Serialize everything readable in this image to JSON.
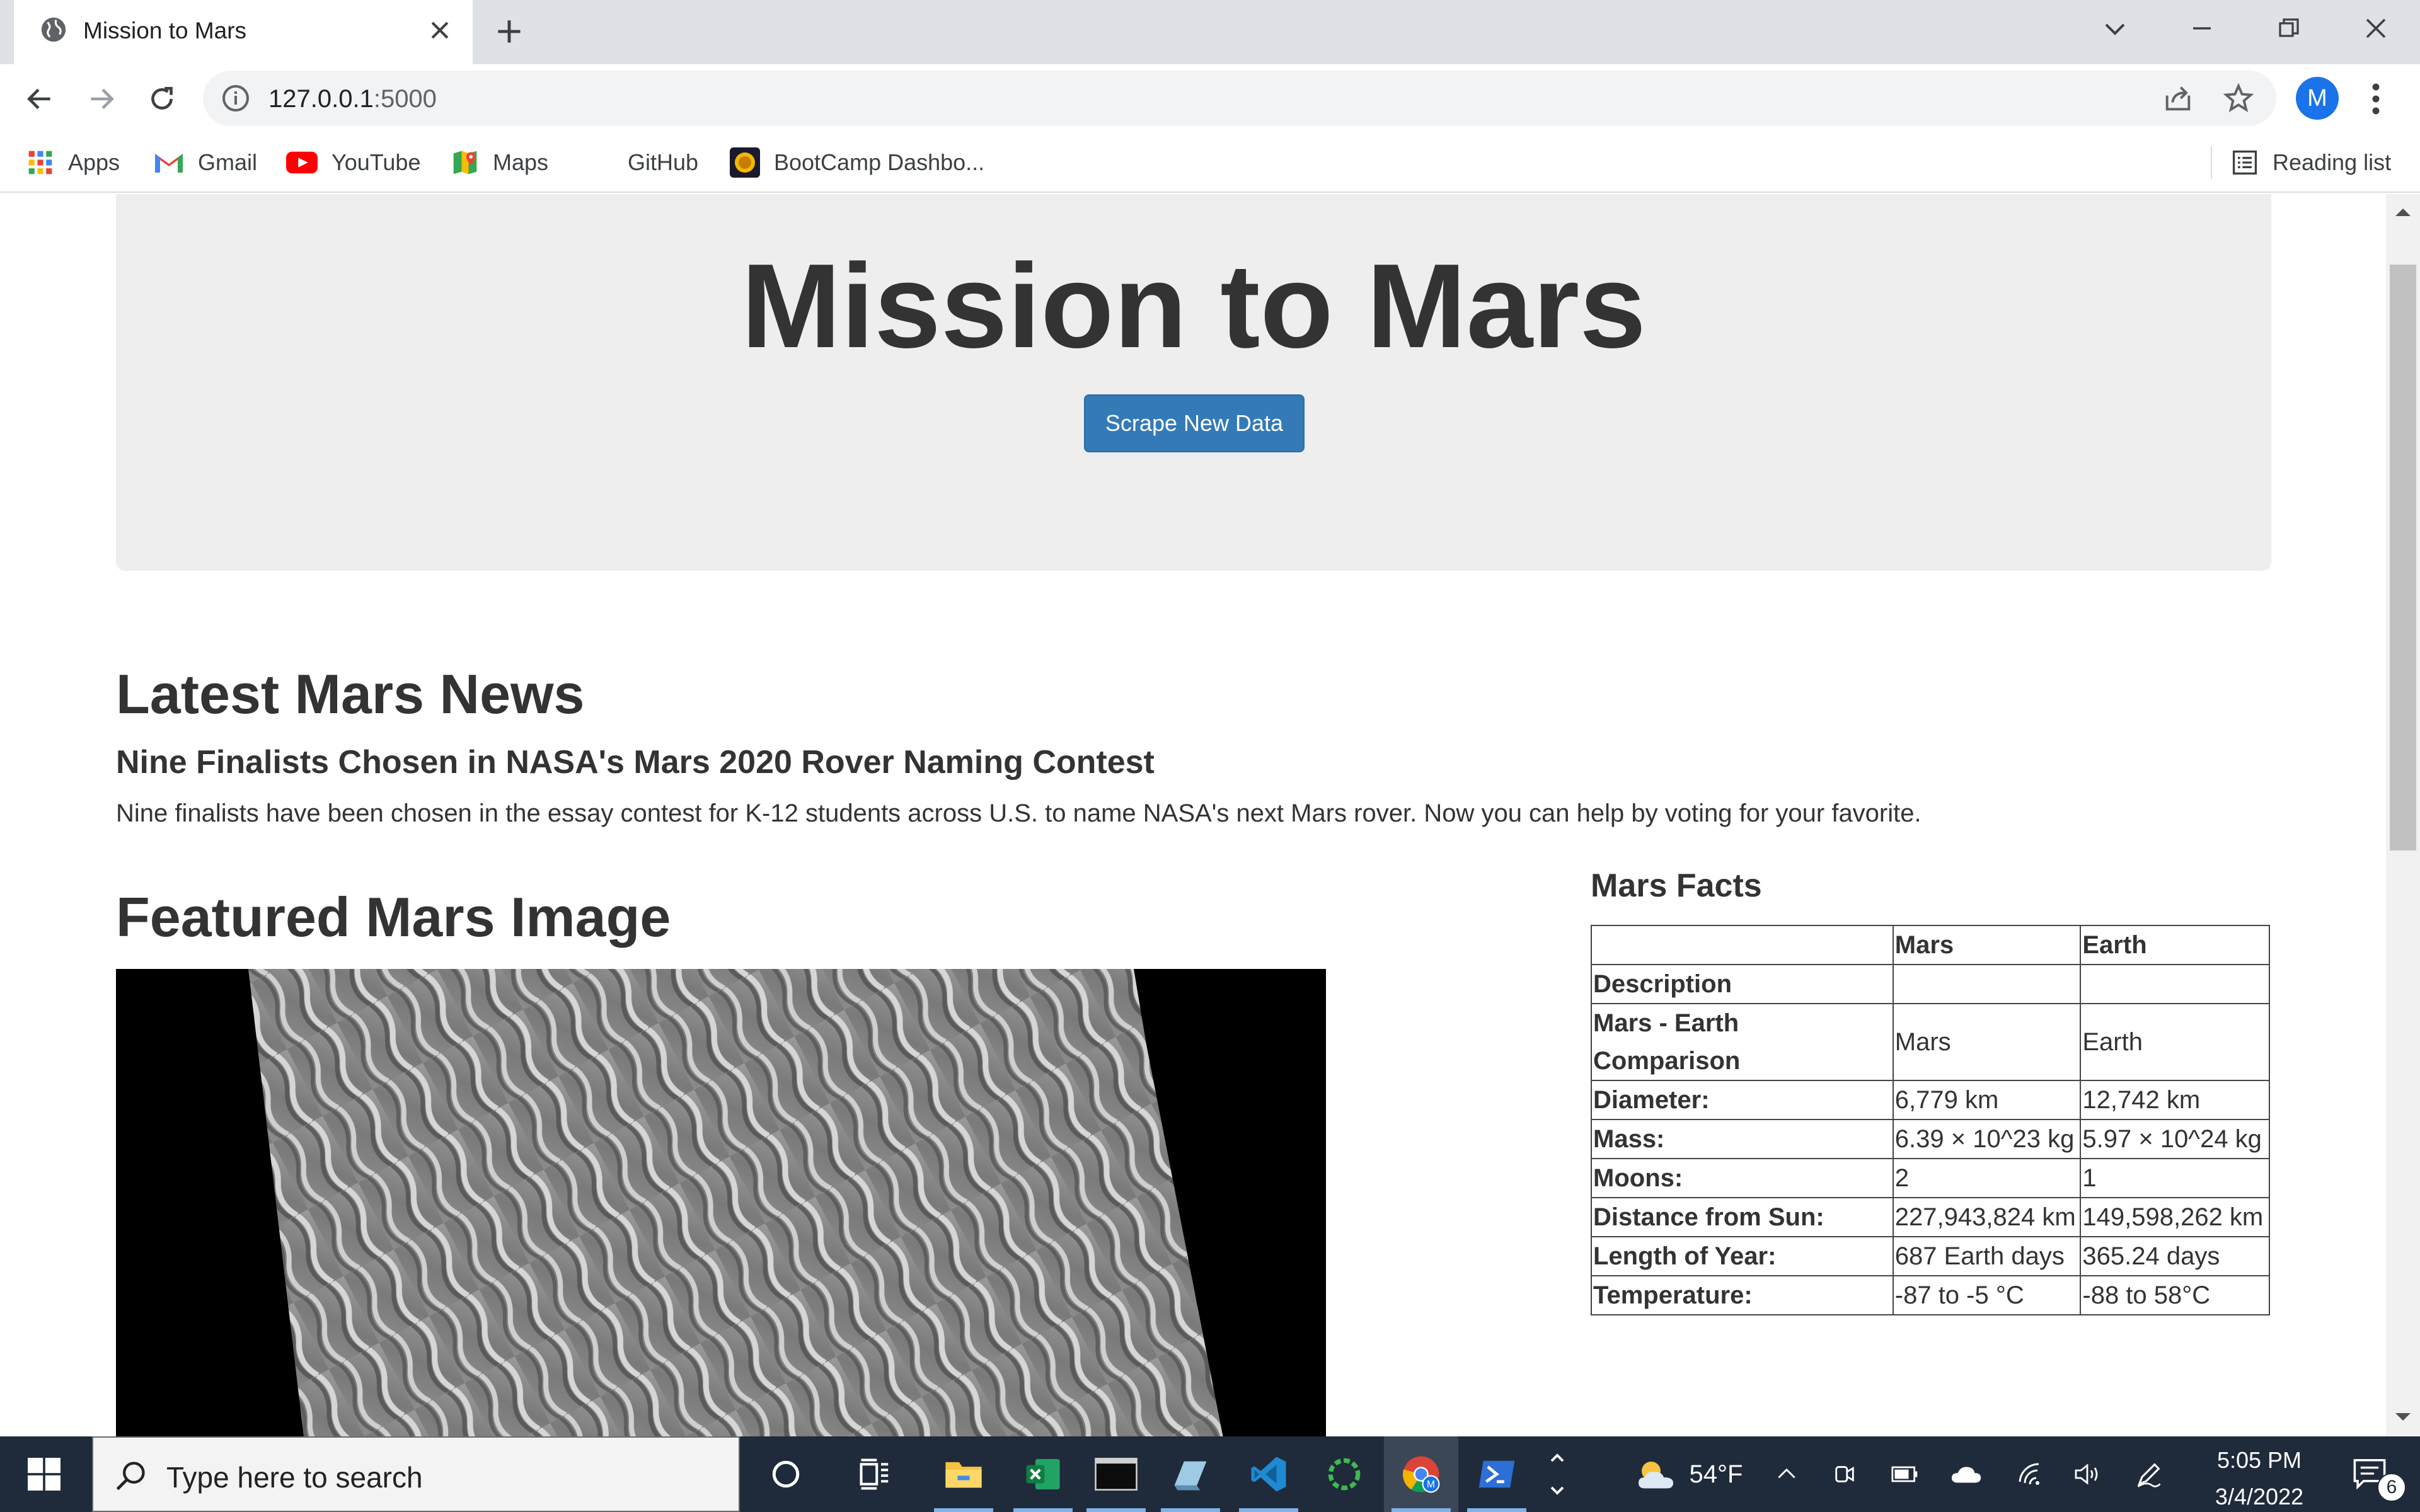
{
  "browser": {
    "tab_title": "Mission to Mars",
    "url_host": "127.0.0.1",
    "url_port": ":5000",
    "profile_initial": "M",
    "bookmarks": [
      {
        "label": "Apps",
        "icon": "apps-grid-icon"
      },
      {
        "label": "Gmail",
        "icon": "gmail-icon"
      },
      {
        "label": "YouTube",
        "icon": "youtube-icon"
      },
      {
        "label": "Maps",
        "icon": "maps-icon"
      },
      {
        "label": "GitHub",
        "icon": "github-icon"
      },
      {
        "label": "BootCamp Dashbo...",
        "icon": "bootcamp-icon"
      }
    ],
    "reading_list": "Reading list"
  },
  "page": {
    "title": "Mission to Mars",
    "scrape_button": "Scrape New Data",
    "news": {
      "heading": "Latest Mars News",
      "title": "Nine Finalists Chosen in NASA's Mars 2020 Rover Naming Contest",
      "paragraph": "Nine finalists have been chosen in the essay contest for K-12 students across U.S. to name NASA's next Mars rover. Now you can help by voting for your favorite."
    },
    "featured_image_heading": "Featured Mars Image",
    "facts": {
      "heading": "Mars Facts",
      "columns": [
        "",
        "Mars",
        "Earth"
      ],
      "rows": [
        [
          "Description",
          "",
          ""
        ],
        [
          "Mars - Earth Comparison",
          "Mars",
          "Earth"
        ],
        [
          "Diameter:",
          "6,779 km",
          "12,742 km"
        ],
        [
          "Mass:",
          "6.39 × 10^23 kg",
          "5.97 × 10^24 kg"
        ],
        [
          "Moons:",
          "2",
          "1"
        ],
        [
          "Distance from Sun:",
          "227,943,824 km",
          "149,598,262 km"
        ],
        [
          "Length of Year:",
          "687 Earth days",
          "365.24 days"
        ],
        [
          "Temperature:",
          "-87 to -5 °C",
          "-88 to 58°C"
        ]
      ]
    }
  },
  "taskbar": {
    "search_placeholder": "Type here to search",
    "weather": "54°F",
    "time": "5:05 PM",
    "date": "3/4/2022",
    "notification_count": "6"
  },
  "colors": {
    "accent_button": "#337ab7",
    "jumbotron_bg": "#eeeeee",
    "taskbar_bg": "#1f2a3a"
  }
}
